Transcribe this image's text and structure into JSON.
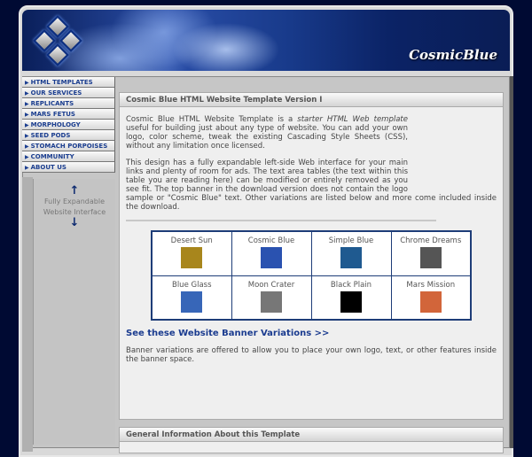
{
  "banner": {
    "brand": "CosmicBlue"
  },
  "nav": {
    "items": [
      "HTML TEMPLATES",
      "OUR SERVICES",
      "REPLICANTS",
      "MARS FETUS",
      "MORPHOLOGY",
      "SEED PODS",
      "STOMACH PORPOISES",
      "COMMUNITY",
      "ABOUT US"
    ]
  },
  "sidebar": {
    "line1": "Fully Expandable",
    "line2": "Website Interface"
  },
  "main": {
    "title": "Cosmic Blue HTML Website Template Version I",
    "p1_a": "Cosmic Blue HTML Website Template is a ",
    "p1_em": "starter HTML Web template",
    "p1_b": " useful for building just about any type of website. You can add your own logo, color scheme, tweak the existing Cascading Style Sheets (CSS), without any limitation once licensed.",
    "p2": "This design has a fully expandable left-side Web interface for your main links and plenty of room for ads. The text area tables (the text within this table you are reading here) can be modified or entirely removed as you see fit. The top banner in the download version does not contain the logo sample or \"Cosmic Blue\" text. Other variations are listed below and more come included inside the download.",
    "variations": [
      {
        "name": "Desert Sun",
        "color": "#a8861c"
      },
      {
        "name": "Cosmic Blue",
        "color": "#2a52b0"
      },
      {
        "name": "Simple Blue",
        "color": "#1f5a90"
      },
      {
        "name": "Chrome Dreams",
        "color": "#555555"
      },
      {
        "name": "Blue Glass",
        "color": "#3766b8"
      },
      {
        "name": "Moon Crater",
        "color": "#777777"
      },
      {
        "name": "Black Plain",
        "color": "#000000"
      },
      {
        "name": "Mars Mission",
        "color": "#d2653a"
      }
    ],
    "link": "See these Website Banner Variations >>",
    "p3": "Banner variations are offered to allow you to place your own logo, text, or other features inside the banner space."
  },
  "section2": {
    "title": "General Information About this Template"
  }
}
